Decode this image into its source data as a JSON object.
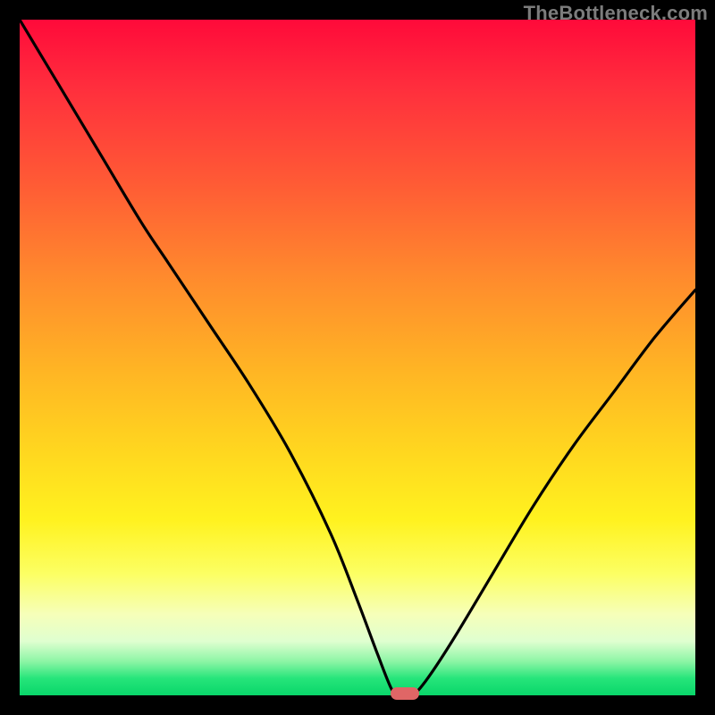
{
  "watermark": "TheBottleneck.com",
  "chart_data": {
    "type": "line",
    "title": "",
    "xlabel": "",
    "ylabel": "",
    "xlim": [
      0,
      100
    ],
    "ylim": [
      0,
      100
    ],
    "grid": false,
    "legend": false,
    "series": [
      {
        "name": "bottleneck-curve",
        "x": [
          0,
          6,
          12,
          18,
          22,
          28,
          34,
          40,
          46,
          50,
          53,
          55,
          56,
          58,
          60,
          64,
          70,
          76,
          82,
          88,
          94,
          100
        ],
        "values": [
          100,
          90,
          80,
          70,
          64,
          55,
          46,
          36,
          24,
          14,
          6,
          1,
          0,
          0,
          2,
          8,
          18,
          28,
          37,
          45,
          53,
          60
        ]
      }
    ],
    "marker": {
      "x": 57,
      "y": 0
    },
    "gradient_stops": [
      {
        "pos": 0,
        "color": "#ff0a3a"
      },
      {
        "pos": 0.5,
        "color": "#ffb524"
      },
      {
        "pos": 0.8,
        "color": "#fdff40"
      },
      {
        "pos": 0.95,
        "color": "#8cf5a5"
      },
      {
        "pos": 1.0,
        "color": "#09d66a"
      }
    ]
  }
}
